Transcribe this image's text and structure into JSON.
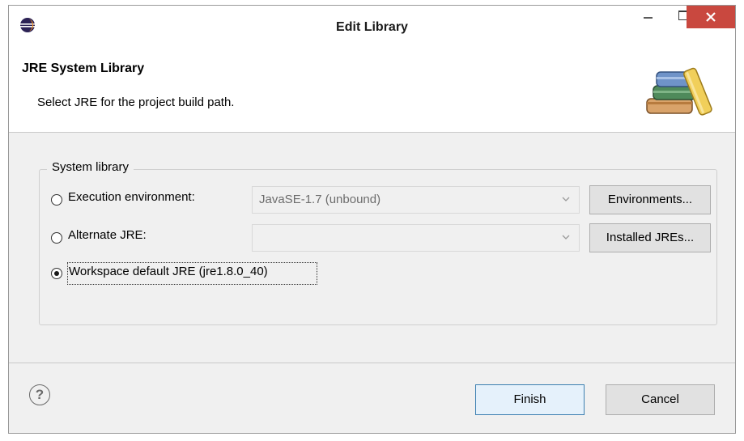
{
  "window": {
    "title": "Edit Library"
  },
  "header": {
    "title": "JRE System Library",
    "description": "Select JRE for the project build path."
  },
  "group": {
    "label": "System library",
    "options": [
      {
        "label": "Execution environment:",
        "selected": false,
        "combo_value": "JavaSE-1.7 (unbound)",
        "button_label": "Environments..."
      },
      {
        "label": "Alternate JRE:",
        "selected": false,
        "combo_value": "",
        "button_label": "Installed JREs..."
      },
      {
        "label": "Workspace default JRE (jre1.8.0_40)",
        "selected": true
      }
    ]
  },
  "footer": {
    "help_glyph": "?",
    "finish_label": "Finish",
    "cancel_label": "Cancel"
  },
  "colors": {
    "close_button": "#c9483f",
    "finish_border": "#3c7fb1",
    "dialog_background": "#f0f0f0"
  }
}
